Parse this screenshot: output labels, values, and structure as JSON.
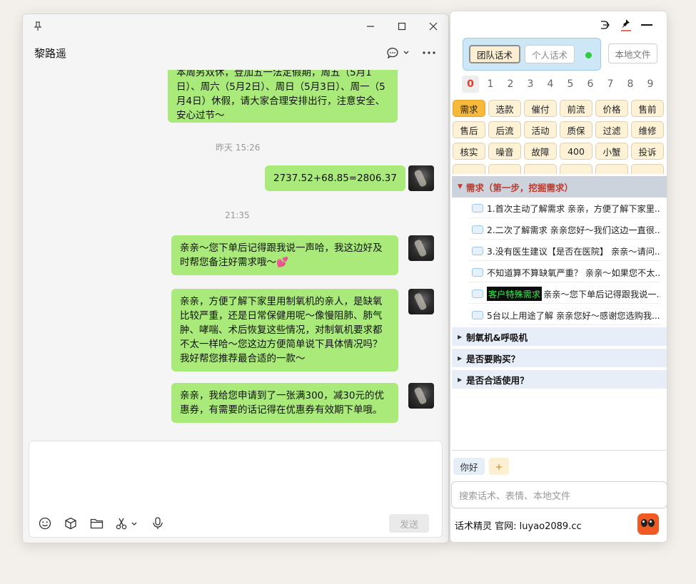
{
  "chat": {
    "contact_name": "黎路遥",
    "messages": [
      {
        "type": "bubble",
        "text": "本周另双休，登加五一法定假期，周五（5月1日）、周六（5月2日）、周日（5月3日）、周一（5月4日）休假，请大家合理安排出行，注意安全、安心过节～"
      },
      {
        "type": "timestamp",
        "text": "昨天 15:26"
      },
      {
        "type": "bubble",
        "text": "2737.52+68.85=2806.37"
      },
      {
        "type": "timestamp",
        "text": "21:35"
      },
      {
        "type": "bubble",
        "text": "亲亲～您下单后记得跟我说一声哈，我这边好及时帮您备注好需求哦～💕"
      },
      {
        "type": "bubble",
        "text": "亲亲，方便了解下家里用制氧机的亲人，是缺氧比较严重，还是日常保健用呢～像慢阻肺、肺气肿、哮喘、术后恢复这些情况，对制氧机要求都不太一样哈～您这边方便简单说下具体情况吗？我好帮您推荐最合适的一款～"
      },
      {
        "type": "bubble",
        "text": "亲亲，我给您申请到了一张满300，减30元的优惠券，有需要的话记得在优惠券有效期下单哦。"
      }
    ],
    "send_label": "发送",
    "toolbar_icons": [
      "emoji-icon",
      "cube-icon",
      "folder-icon",
      "scissors-icon",
      "microphone-icon"
    ]
  },
  "assistant": {
    "tabs": [
      "团队话术",
      "个人话术"
    ],
    "local_files_label": "本地文件",
    "numbers": [
      "0",
      "1",
      "2",
      "3",
      "4",
      "5",
      "6",
      "7",
      "8",
      "9"
    ],
    "categories": [
      "需求",
      "选款",
      "催付",
      "前流",
      "价格",
      "售前",
      "售后",
      "后流",
      "活动",
      "质保",
      "过滤",
      "维修",
      "核实",
      "噪音",
      "故障",
      "400",
      "小蟹",
      "投诉"
    ],
    "section_title": "需求（第一步，挖掘需求）",
    "scripts": [
      {
        "tag": "",
        "text": "1.首次主动了解需求 亲亲，方便了解下家里..."
      },
      {
        "tag": "",
        "text": "2.二次了解需求 亲亲您好～我们这边一直很..."
      },
      {
        "tag": "",
        "text": "3.没有医生建议【是否在医院】 亲亲～请问..."
      },
      {
        "tag": "",
        "text": "不知道算不算缺氧严重？ 亲亲～如果您不太..."
      },
      {
        "tag": "客户特殊需求",
        "text": "亲亲～您下单后记得跟我说一..."
      },
      {
        "tag": "",
        "text": "5台以上用途了解 亲亲您好～感谢您选购我..."
      }
    ],
    "groups": [
      "制氧机&呼吸机",
      "是否要购买？",
      "是否合适使用？"
    ],
    "quick_replies": [
      "你好",
      "+"
    ],
    "search_placeholder": "搜索话术、表情、本地文件",
    "footer": "话术精灵 官网: luyao2089.cc",
    "colors": {
      "accent": "#f6b93b",
      "bubble": "#a9ea7a",
      "status": "#2ecc40",
      "section_text": "#c0392b"
    }
  }
}
